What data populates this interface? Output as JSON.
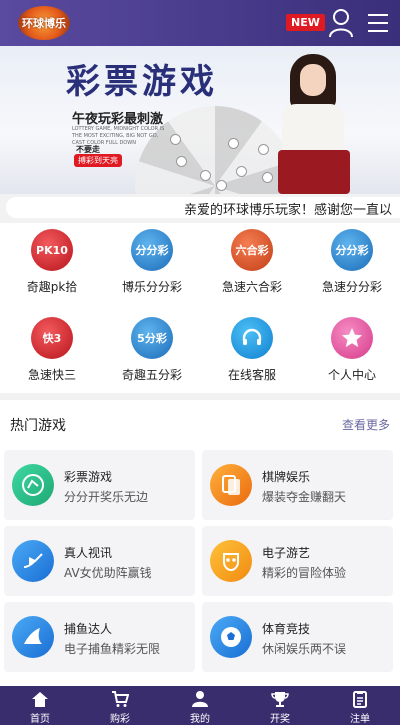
{
  "header": {
    "logo_text": "环球博乐",
    "new_badge": "NEW",
    "user_icon": "user-icon",
    "menu_icon": "menu-icon"
  },
  "banner": {
    "title": "彩票游戏",
    "subtitle": "午夜玩彩最刺激",
    "fine_print": "LOTTERY GAME, MIDNIGHT COLOR IS THE MOST EXCITING, BIG NOT GO, CAST COLOR FULL DOWN",
    "no_text": "不要走",
    "pill_text": "搏彩到天亮"
  },
  "marquee": {
    "text": "亲爱的环球博乐玩家！感谢您一直以"
  },
  "quick_entries": [
    {
      "label": "奇趣pk拾",
      "icon": "pk10-icon",
      "icon_text": "PK10",
      "color": "#d8262b"
    },
    {
      "label": "博乐分分彩",
      "icon": "ffc-icon",
      "icon_text": "分分彩",
      "color": "#2d8fd6"
    },
    {
      "label": "急速六合彩",
      "icon": "liuhe-icon",
      "icon_text": "六合彩",
      "color": "#e4572a"
    },
    {
      "label": "急速分分彩",
      "icon": "jsffc-icon",
      "icon_text": "分分彩",
      "color": "#2d8fd6"
    },
    {
      "label": "急速快三",
      "icon": "k3-icon",
      "icon_text": "快3",
      "color": "#d8262b"
    },
    {
      "label": "奇趣五分彩",
      "icon": "wfc-icon",
      "icon_text": "5分彩",
      "color": "#2d8fd6"
    },
    {
      "label": "在线客服",
      "icon": "headset-icon",
      "icon_text": "",
      "color": "#1a96e6"
    },
    {
      "label": "个人中心",
      "icon": "star-icon",
      "icon_text": "",
      "color": "#e84d9a"
    }
  ],
  "hot": {
    "title": "热门游戏",
    "more": "查看更多"
  },
  "games": [
    {
      "name": "彩票游戏",
      "desc": "分分开奖乐无边",
      "icon": "lottery-icon",
      "color": "#2fc38d"
    },
    {
      "name": "棋牌娱乐",
      "desc": "爆装夺金赚翻天",
      "icon": "cards-icon",
      "color": "#f08a1f"
    },
    {
      "name": "真人视讯",
      "desc": "AV女优助阵赢钱",
      "icon": "video-icon",
      "color": "#2a8ee8"
    },
    {
      "name": "电子游艺",
      "desc": "精彩的冒险体验",
      "icon": "mask-icon",
      "color": "#f5a21d"
    },
    {
      "name": "捕鱼达人",
      "desc": "电子捕鱼精彩无限",
      "icon": "shark-icon",
      "color": "#2a8ee8"
    },
    {
      "name": "体育竞技",
      "desc": "休闲娱乐两不误",
      "icon": "soccer-icon",
      "color": "#2a8ee8"
    }
  ],
  "tabbar": [
    {
      "label": "首页",
      "icon": "home-icon"
    },
    {
      "label": "购彩",
      "icon": "cart-icon"
    },
    {
      "label": "我的",
      "icon": "profile-icon"
    },
    {
      "label": "开奖",
      "icon": "trophy-icon"
    },
    {
      "label": "注单",
      "icon": "clipboard-icon"
    }
  ]
}
